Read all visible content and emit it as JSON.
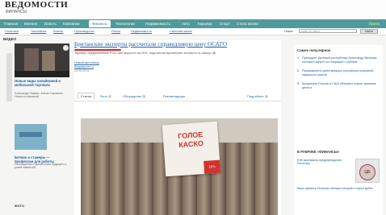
{
  "site": {
    "logo": "ВЕДОМОСТИ",
    "section": "ФИНАНСЫ"
  },
  "nav": {
    "items": [
      "Главная",
      "Мнения",
      "Власть",
      "Компании",
      "Финансы",
      "Технологии",
      "Недвижимость",
      "Авто",
      "Карьера",
      "Спорт",
      "Стиль жизни"
    ],
    "active_index": 4,
    "right": "Газета"
  },
  "subnav": {
    "items": [
      "Политика",
      "Экономика",
      "Бизнес",
      "Производство",
      "Рынки",
      "Недвижимость",
      "Светская жизнь"
    ],
    "search_label": "Поиск",
    "search_placeholder": "поиск по сайту",
    "search_button": "Найти"
  },
  "left": {
    "section_title": "ВИДЕО",
    "news1_title": "Новые виды онлайновой и мобильной торговли",
    "news1_desc": "Александр Ложкин, Алена Сорокина. Новости компаний",
    "news2_title": "Бэтмэн и стажеры — профессии для работы",
    "news2_desc": "Рассуждения о профессиях будущего и рынке вакансий",
    "footer": "ФОТО"
  },
  "article": {
    "headline": "Британские эксперты рассчитали справедливую цену ОСАГО",
    "lead": "Тарифы, предложенные РСА, уже выросли на 20%, подсчитали британские эксперты по заказу ЦБ",
    "source_link": "Новый автообзор",
    "source_name": "Ведомости.ru",
    "date": "26.05.2014",
    "tabs": [
      {
        "label": "Статья",
        "count": ""
      },
      {
        "label": "Фото",
        "count": "2"
      },
      {
        "label": "Обсуждение",
        "count": "3"
      },
      {
        "label": "Рекомендации",
        "count": ""
      },
      {
        "label": "Подробнее",
        "count": "6"
      }
    ],
    "sign_text_1": "ГОЛОЕ",
    "sign_text_2": "КАСКО",
    "sign_price": "15%"
  },
  "right": {
    "title": "Самое популярное",
    "items": [
      "Президент Деловой республики Александр Вихрова наложил запрет на операции с рублем",
      "Руководители действующих российских компаний нарушили законы",
      "Кредиторы России и США обещают новые заемные деньги"
    ],
    "section2_title": "В РУБРИКЕ «ФИНАНСЫ»",
    "news1": "ЕЭК выставила предупреждения Росатому",
    "news2": "Вице-премьер Пельшин обещал нагрузки о курсе рубля",
    "badge": "ЦБ"
  }
}
